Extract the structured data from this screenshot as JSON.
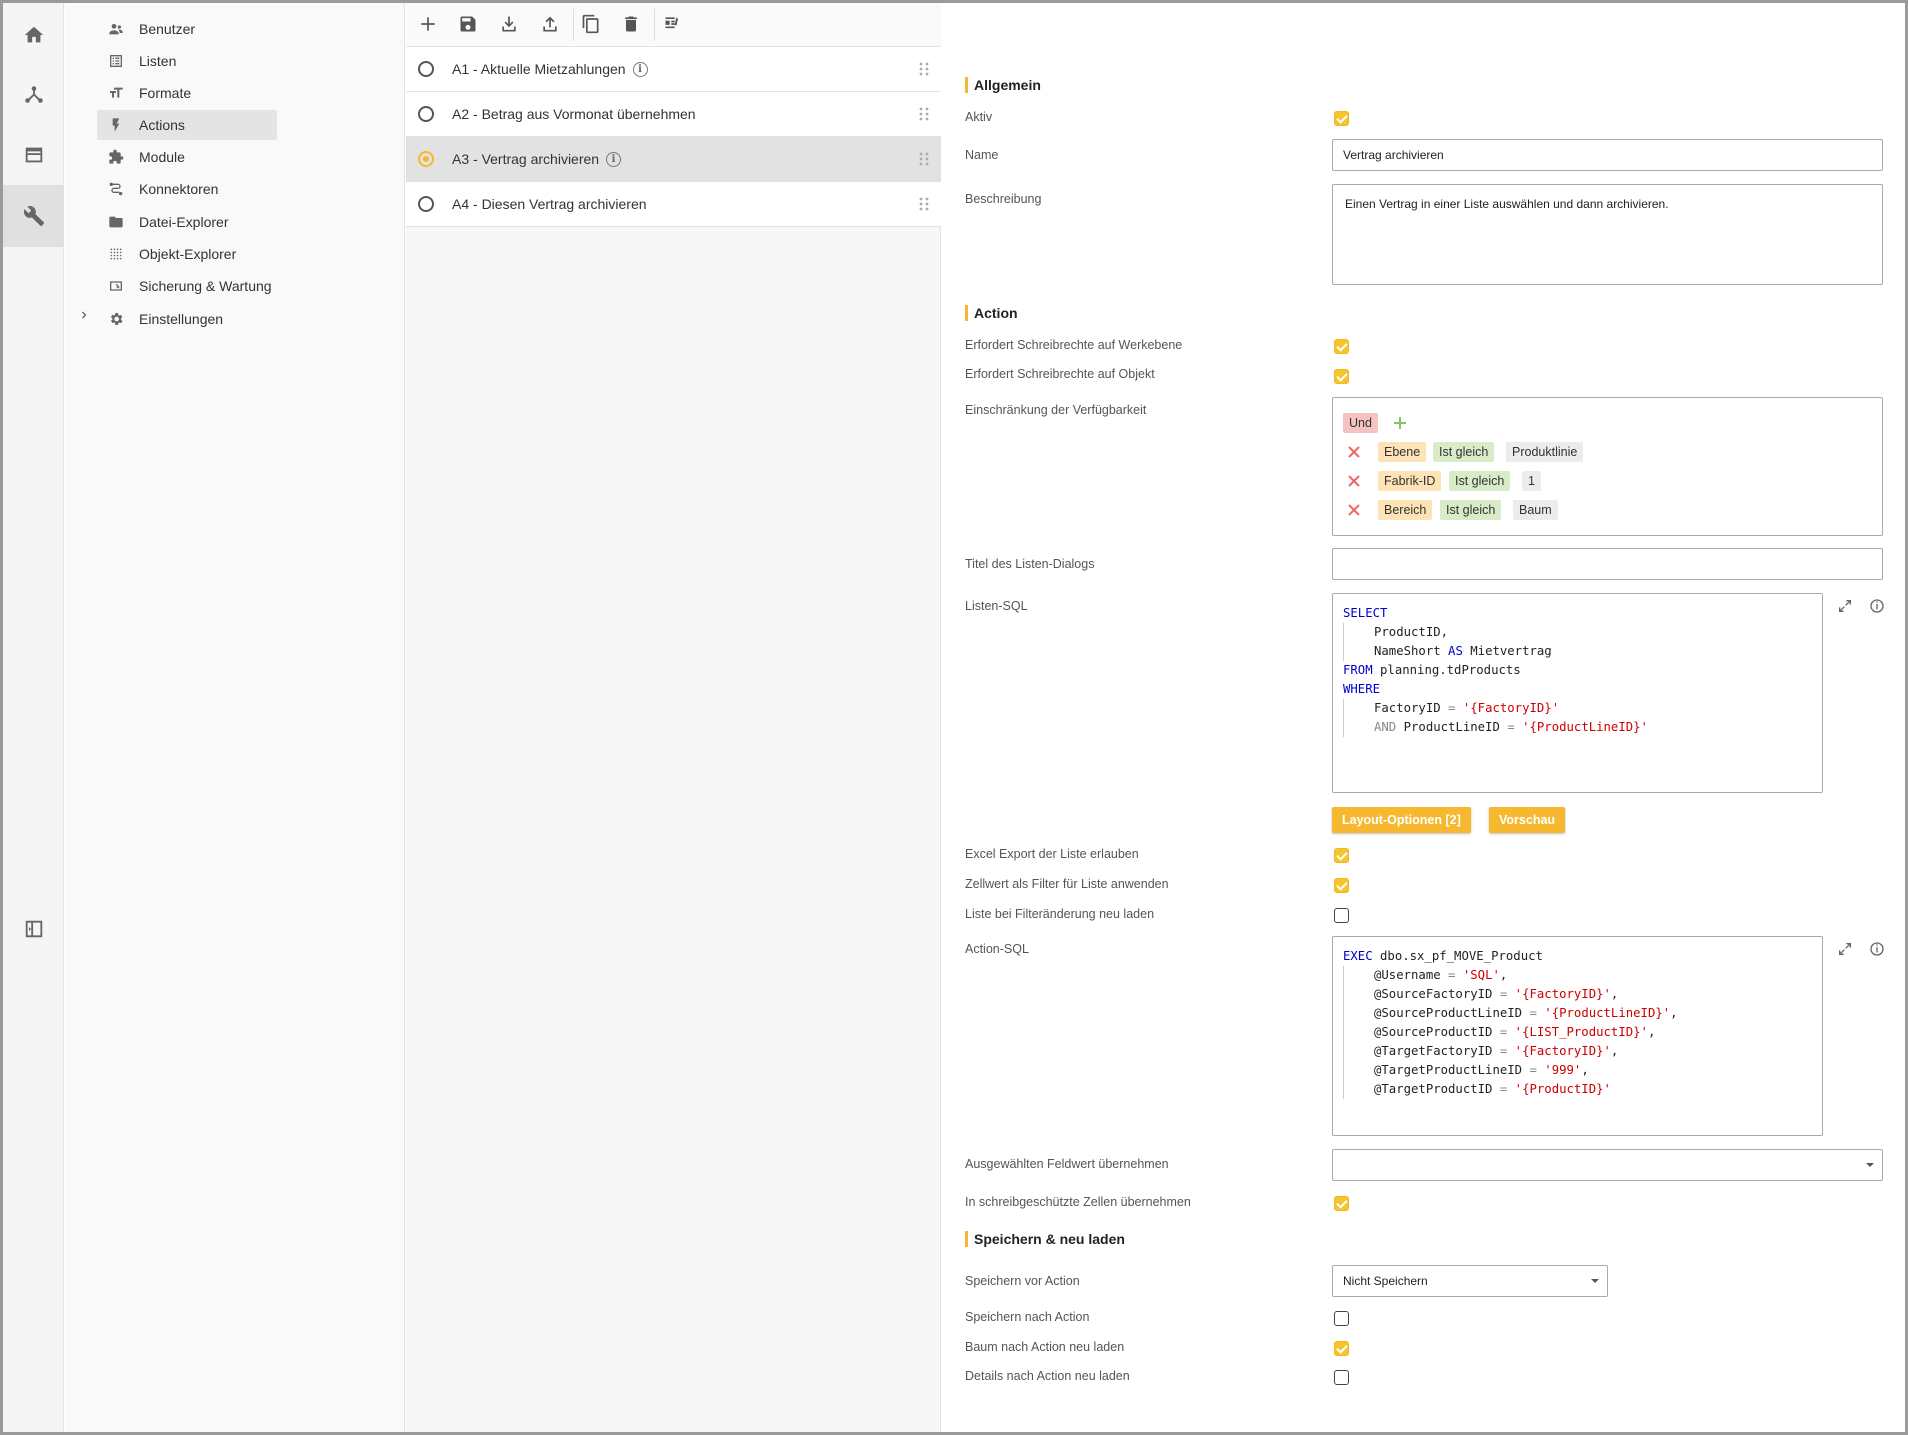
{
  "rail": {
    "items": [
      {
        "icon": "home-icon"
      },
      {
        "icon": "hierarchy-icon"
      },
      {
        "icon": "window-icon"
      },
      {
        "icon": "wrench-icon",
        "active": true
      },
      {
        "icon": "collapse-sidebar-icon"
      }
    ]
  },
  "nav": {
    "items": [
      {
        "label": "Benutzer",
        "icon": "users-icon"
      },
      {
        "label": "Listen",
        "icon": "list-icon"
      },
      {
        "label": "Formate",
        "icon": "text-format-icon"
      },
      {
        "label": "Actions",
        "icon": "lightning-icon",
        "active": true
      },
      {
        "label": "Module",
        "icon": "puzzle-icon"
      },
      {
        "label": "Konnektoren",
        "icon": "connector-icon"
      },
      {
        "label": "Datei-Explorer",
        "icon": "folder-icon"
      },
      {
        "label": "Objekt-Explorer",
        "icon": "grid-dots-icon"
      },
      {
        "label": "Sicherung & Wartung",
        "icon": "backup-icon"
      },
      {
        "label": "Einstellungen",
        "icon": "gear-icon"
      }
    ]
  },
  "toolbar": {
    "buttons": [
      "add-icon",
      "save-icon",
      "download-icon",
      "upload-icon",
      "copy-icon",
      "delete-icon",
      "layout-edit-icon"
    ]
  },
  "actions": [
    {
      "label": "A1 - Aktuelle Mietzahlungen",
      "info": true,
      "selected": false
    },
    {
      "label": "A2 - Betrag aus Vormonat übernehmen",
      "info": false,
      "selected": false
    },
    {
      "label": "A3 - Vertrag archivieren",
      "info": true,
      "selected": true
    },
    {
      "label": "A4 - Diesen Vertrag archivieren",
      "info": false,
      "selected": false
    }
  ],
  "detail": {
    "sec_allgemein": "Allgemein",
    "aktiv_label": "Aktiv",
    "aktiv": true,
    "name_label": "Name",
    "name_value": "Vertrag archivieren",
    "beschreibung_label": "Beschreibung",
    "beschreibung_value": "Einen Vertrag in einer Liste auswählen und dann archivieren.",
    "sec_action": "Action",
    "werk_label": "Erfordert Schreibrechte auf Werkebene",
    "werk": true,
    "objekt_label": "Erfordert Schreibrechte auf Objekt",
    "objekt": true,
    "einschr_label": "Einschränkung der Verfügbarkeit",
    "filter": {
      "operator": "Und",
      "conditions": [
        {
          "field": "Ebene",
          "op": "Ist gleich",
          "value": "Produktlinie"
        },
        {
          "field": "Fabrik-ID",
          "op": "Ist gleich",
          "value": "1"
        },
        {
          "field": "Bereich",
          "op": "Ist gleich",
          "value": "Baum"
        }
      ]
    },
    "titel_label": "Titel des Listen-Dialogs",
    "titel_value": "",
    "listen_sql_label": "Listen-SQL",
    "layout_btn": "Layout-Optionen [2]",
    "vorschau_btn": "Vorschau",
    "excel_label": "Excel Export der Liste erlauben",
    "excel": true,
    "zellwert_label": "Zellwert als Filter für Liste anwenden",
    "zellwert": true,
    "neu_laden_label": "Liste bei Filteränderung neu laden",
    "neu_laden": false,
    "action_sql_label": "Action-SQL",
    "feldwert_label": "Ausgewählten Feldwert übernehmen",
    "feldwert_value": "",
    "schreibgesch_label": "In schreibgeschützte Zellen übernehmen",
    "schreibgesch": true,
    "sec_speichern": "Speichern & neu laden",
    "speichern_vor_label": "Speichern vor Action",
    "speichern_vor_value": "Nicht Speichern",
    "speichern_nach_label": "Speichern nach Action",
    "speichern_nach": false,
    "baum_label": "Baum nach Action neu laden",
    "baum": true,
    "details_label": "Details nach Action neu laden",
    "details": false
  },
  "listen_sql": [
    [
      {
        "t": "SELECT",
        "c": "kw"
      }
    ],
    [
      {
        "t": "ProductID,",
        "c": "",
        "i": 1
      }
    ],
    [
      {
        "t": "NameShort ",
        "c": "",
        "i": 1
      },
      {
        "t": "AS",
        "c": "kw"
      },
      {
        "t": " Mietvertrag",
        "c": ""
      }
    ],
    [
      {
        "t": "FROM",
        "c": "kw"
      },
      {
        "t": " planning.tdProducts",
        "c": ""
      }
    ],
    [
      {
        "t": "WHERE",
        "c": "kw"
      }
    ],
    [
      {
        "t": "FactoryID ",
        "c": "",
        "i": 1
      },
      {
        "t": "=",
        "c": "op"
      },
      {
        "t": " ",
        "c": ""
      },
      {
        "t": "'{FactoryID}'",
        "c": "str"
      }
    ],
    [
      {
        "t": "AND",
        "c": "op",
        "i": 1
      },
      {
        "t": " ProductLineID ",
        "c": ""
      },
      {
        "t": "=",
        "c": "op"
      },
      {
        "t": " ",
        "c": ""
      },
      {
        "t": "'{ProductLineID}'",
        "c": "str"
      }
    ]
  ],
  "action_sql": [
    [
      {
        "t": "EXEC",
        "c": "kw"
      },
      {
        "t": " dbo.sx_pf_MOVE_Product",
        "c": ""
      }
    ],
    [
      {
        "t": "@Username ",
        "c": "",
        "i": 1
      },
      {
        "t": "=",
        "c": "op"
      },
      {
        "t": " ",
        "c": ""
      },
      {
        "t": "'SQL'",
        "c": "str"
      },
      {
        "t": ",",
        "c": ""
      }
    ],
    [
      {
        "t": "@SourceFactoryID ",
        "c": "",
        "i": 1
      },
      {
        "t": "=",
        "c": "op"
      },
      {
        "t": " ",
        "c": ""
      },
      {
        "t": "'{FactoryID}'",
        "c": "str"
      },
      {
        "t": ",",
        "c": ""
      }
    ],
    [
      {
        "t": "@SourceProductLineID ",
        "c": "",
        "i": 1
      },
      {
        "t": "=",
        "c": "op"
      },
      {
        "t": " ",
        "c": ""
      },
      {
        "t": "'{ProductLineID}'",
        "c": "str"
      },
      {
        "t": ",",
        "c": ""
      }
    ],
    [
      {
        "t": "@SourceProductID ",
        "c": "",
        "i": 1
      },
      {
        "t": "=",
        "c": "op"
      },
      {
        "t": " ",
        "c": ""
      },
      {
        "t": "'{LIST_ProductID}'",
        "c": "str"
      },
      {
        "t": ",",
        "c": ""
      }
    ],
    [
      {
        "t": "@TargetFactoryID ",
        "c": "",
        "i": 1
      },
      {
        "t": "=",
        "c": "op"
      },
      {
        "t": " ",
        "c": ""
      },
      {
        "t": "'{FactoryID}'",
        "c": "str"
      },
      {
        "t": ",",
        "c": ""
      }
    ],
    [
      {
        "t": "@TargetProductLineID ",
        "c": "",
        "i": 1
      },
      {
        "t": "=",
        "c": "op"
      },
      {
        "t": " ",
        "c": ""
      },
      {
        "t": "'999'",
        "c": "str"
      },
      {
        "t": ",",
        "c": ""
      }
    ],
    [
      {
        "t": "@TargetProductID ",
        "c": "",
        "i": 1
      },
      {
        "t": "=",
        "c": "op"
      },
      {
        "t": " ",
        "c": ""
      },
      {
        "t": "'{ProductID}'",
        "c": "str"
      }
    ]
  ]
}
